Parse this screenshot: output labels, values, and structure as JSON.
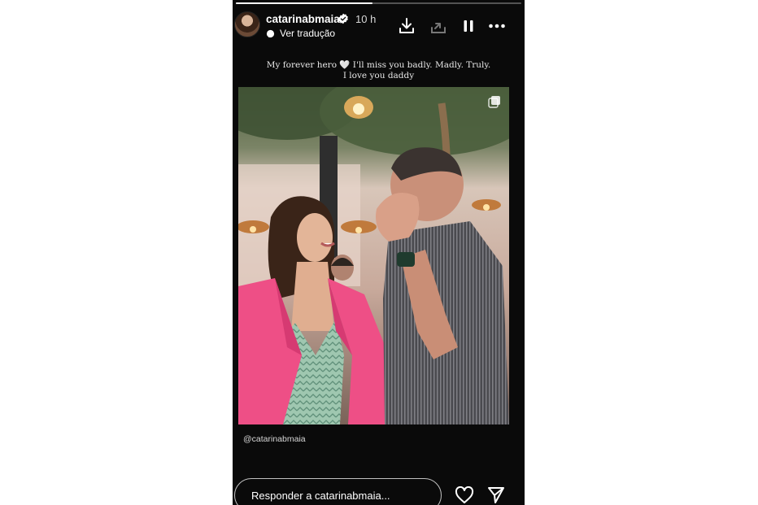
{
  "story": {
    "progress": 0.48,
    "user": {
      "username": "catarinabmaia",
      "verified": true,
      "time_ago": "10 h",
      "translate_label": "Ver tradução"
    },
    "header_actions": [
      "download-icon",
      "share-icon",
      "pause-icon",
      "more-options-icon"
    ],
    "caption_line1": "My forever hero",
    "caption_heart": "🤍",
    "caption_line1b": "I'll miss you badly. Madly. Truly.",
    "caption_line2": "I love you daddy",
    "photo_alt_icon": "multiple-photos-icon",
    "mention": "@catarinabmaia",
    "reply_placeholder": "Responder a catarinabmaia...",
    "footer_actions": [
      "heart-icon",
      "send-icon"
    ]
  },
  "colors": {
    "story_bg": "#0a0a0a",
    "blazer_pink": "#ee4f86",
    "verified_blue": "#ffffff"
  }
}
